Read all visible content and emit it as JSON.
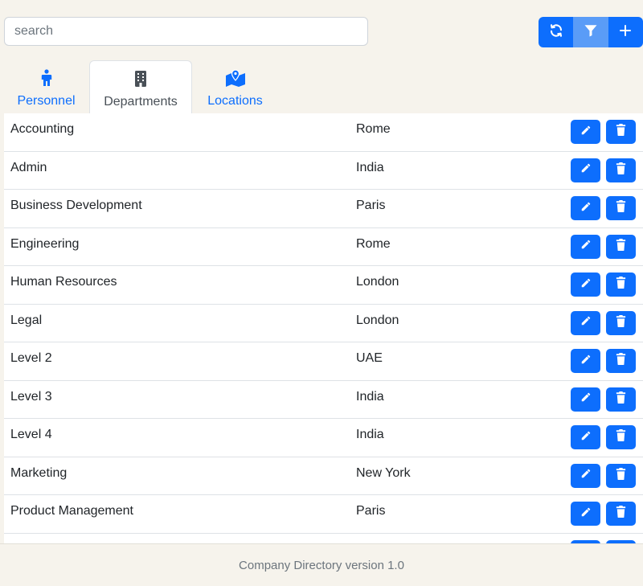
{
  "search": {
    "placeholder": "search",
    "value": ""
  },
  "toolbar": {
    "refresh_icon": "refresh-icon",
    "filter_icon": "filter-icon",
    "add_icon": "plus-icon",
    "accent": "#0d6efd"
  },
  "tabs": [
    {
      "label": "Personnel",
      "icon": "person-icon",
      "active": false
    },
    {
      "label": "Departments",
      "icon": "building-icon",
      "active": true
    },
    {
      "label": "Locations",
      "icon": "map-location-icon",
      "active": false
    }
  ],
  "departments": [
    {
      "name": "Accounting",
      "location": "Rome"
    },
    {
      "name": "Admin",
      "location": "India"
    },
    {
      "name": "Business Development",
      "location": "Paris"
    },
    {
      "name": "Engineering",
      "location": "Rome"
    },
    {
      "name": "Human Resources",
      "location": "London"
    },
    {
      "name": "Legal",
      "location": "London"
    },
    {
      "name": "Level 2",
      "location": "UAE"
    },
    {
      "name": "Level 3",
      "location": "India"
    },
    {
      "name": "Level 4",
      "location": "India"
    },
    {
      "name": "Marketing",
      "location": "New York"
    },
    {
      "name": "Product Management",
      "location": "Paris"
    },
    {
      "name": "",
      "location": ""
    }
  ],
  "row_actions": {
    "edit_icon": "pencil-icon",
    "delete_icon": "trash-icon"
  },
  "footer": {
    "text": "Company Directory version 1.0"
  }
}
